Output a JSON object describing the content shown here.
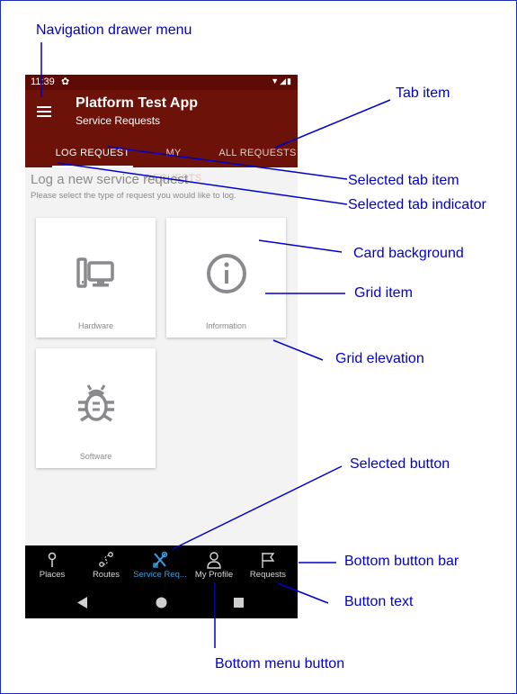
{
  "colors": {
    "annotation": "#0000cc",
    "appbar": "#6d1209",
    "statusbar": "#5e0b05",
    "selected_button": "#3aa0e0"
  },
  "annotations": {
    "nav_drawer": "Navigation drawer menu",
    "tab_item": "Tab item",
    "selected_tab_item": "Selected tab item",
    "selected_tab_indicator": "Selected tab indicator",
    "card_background": "Card background",
    "grid_item": "Grid item",
    "grid_elevation": "Grid elevation",
    "selected_button": "Selected button",
    "bottom_button_bar": "Bottom button bar",
    "button_text": "Button text",
    "bottom_menu_button": "Bottom menu button"
  },
  "status": {
    "time": "11:39",
    "settings_icon": "gear-icon",
    "icons": [
      "wifi-icon",
      "signal-icon",
      "battery-icon"
    ]
  },
  "app": {
    "menu_icon": "hamburger-icon",
    "title": "Platform Test App",
    "subtitle": "Service Requests"
  },
  "tabs": [
    {
      "label": "LOG REQUEST",
      "selected": true
    },
    {
      "label": "MY REQUESTS",
      "selected": false
    },
    {
      "label": "ALL REQUESTS",
      "selected": false
    }
  ],
  "content": {
    "title": "Log a new service request",
    "subtitle": "Please select the type of request you would like to log."
  },
  "cards": [
    {
      "label": "Hardware",
      "icon": "devices-icon"
    },
    {
      "label": "Information",
      "icon": "info-icon"
    },
    {
      "label": "Software",
      "icon": "bug-icon"
    }
  ],
  "bottom_buttons": [
    {
      "label": "Places",
      "icon": "place-pin-icon",
      "selected": false
    },
    {
      "label": "Routes",
      "icon": "route-icon",
      "selected": false
    },
    {
      "label": "Service Req...",
      "icon": "tools-icon",
      "selected": true
    },
    {
      "label": "My Profile",
      "icon": "person-icon",
      "selected": false
    },
    {
      "label": "Requests",
      "icon": "flag-icon",
      "selected": false
    }
  ],
  "system_nav": [
    "back-icon",
    "home-icon",
    "recents-icon"
  ]
}
